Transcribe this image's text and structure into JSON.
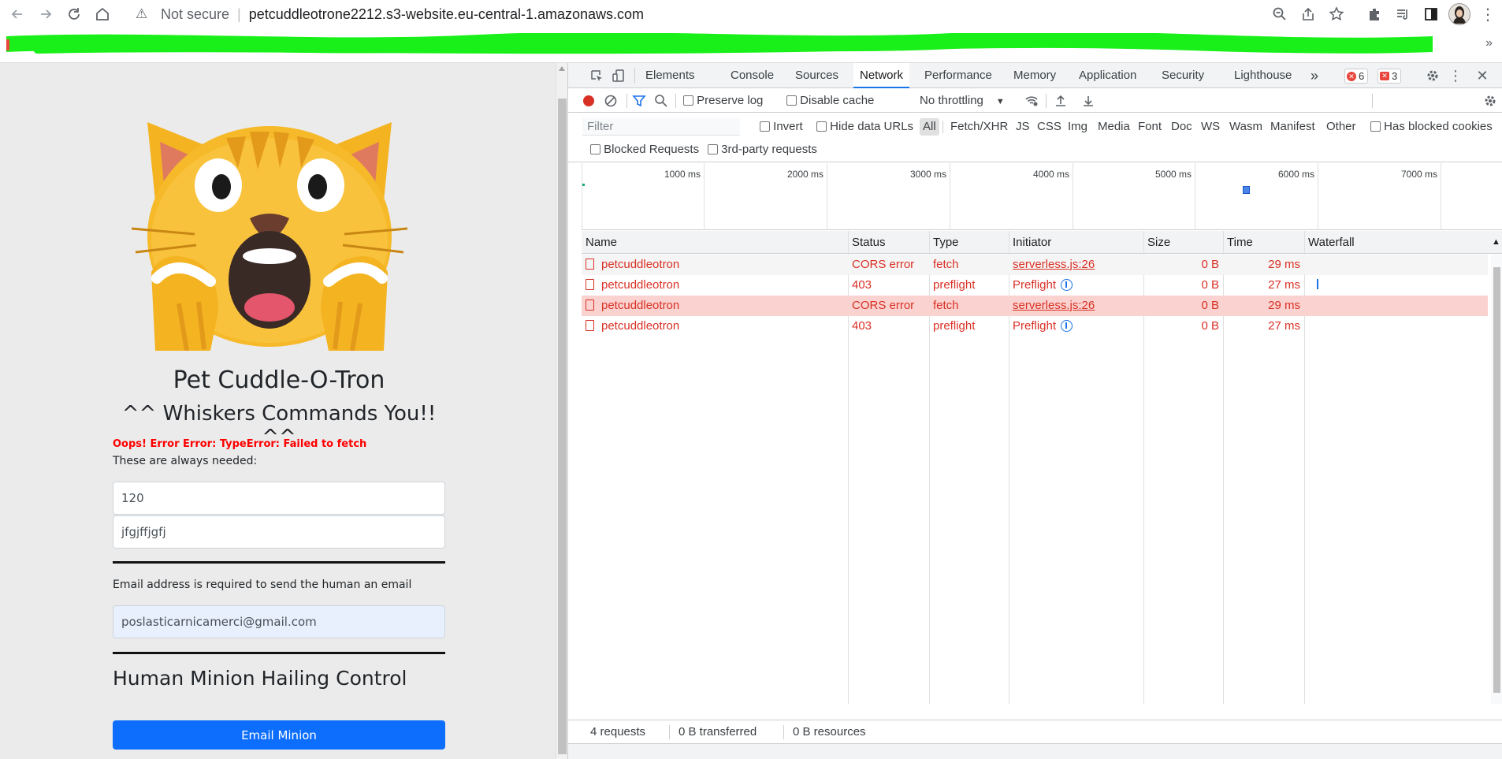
{
  "browser": {
    "security_label": "Not secure",
    "url": "petcuddleotrone2212.s3-website.eu-central-1.amazonaws.com"
  },
  "page": {
    "title": "Pet Cuddle-O-Tron",
    "subtitle": "^^ Whiskers Commands You!! ^^",
    "error_message": "Oops! Error Error: TypeError: Failed to fetch",
    "always_needed": "These are always needed:",
    "input_number_value": "120",
    "input_text_value": "jfgjffjgfj",
    "email_label": "Email address is required to send the human an email",
    "email_value": "poslasticarnicamerci@gmail.com",
    "section_heading": "Human Minion Hailing Control",
    "email_button": "Email Minion"
  },
  "devtools": {
    "tabs": [
      "Elements",
      "Console",
      "Sources",
      "Network",
      "Performance",
      "Memory",
      "Application",
      "Security",
      "Lighthouse"
    ],
    "active_tab": "Network",
    "error_count": "6",
    "issue_count": "3",
    "toolbar": {
      "preserve_log": "Preserve log",
      "disable_cache": "Disable cache",
      "throttling": "No throttling"
    },
    "filter": {
      "placeholder": "Filter",
      "invert": "Invert",
      "hide_data_urls": "Hide data URLs",
      "types": [
        "All",
        "Fetch/XHR",
        "JS",
        "CSS",
        "Img",
        "Media",
        "Font",
        "Doc",
        "WS",
        "Wasm",
        "Manifest",
        "Other"
      ],
      "has_blocked_cookies": "Has blocked cookies",
      "blocked_requests": "Blocked Requests",
      "third_party": "3rd-party requests"
    },
    "overview_ticks": [
      "1000 ms",
      "2000 ms",
      "3000 ms",
      "4000 ms",
      "5000 ms",
      "6000 ms",
      "7000 ms"
    ],
    "columns": [
      "Name",
      "Status",
      "Type",
      "Initiator",
      "Size",
      "Time",
      "Waterfall"
    ],
    "requests": [
      {
        "name": "petcuddleotron",
        "status": "CORS error",
        "type": "fetch",
        "initiator": "serverless.js:26",
        "size": "0 B",
        "time": "29 ms"
      },
      {
        "name": "petcuddleotron",
        "status": "403",
        "type": "preflight",
        "initiator": "Preflight",
        "size": "0 B",
        "time": "27 ms"
      },
      {
        "name": "petcuddleotron",
        "status": "CORS error",
        "type": "fetch",
        "initiator": "serverless.js:26",
        "size": "0 B",
        "time": "29 ms"
      },
      {
        "name": "petcuddleotron",
        "status": "403",
        "type": "preflight",
        "initiator": "Preflight",
        "size": "0 B",
        "time": "27 ms"
      }
    ],
    "status": {
      "requests": "4 requests",
      "transferred": "0 B transferred",
      "resources": "0 B resources"
    }
  }
}
